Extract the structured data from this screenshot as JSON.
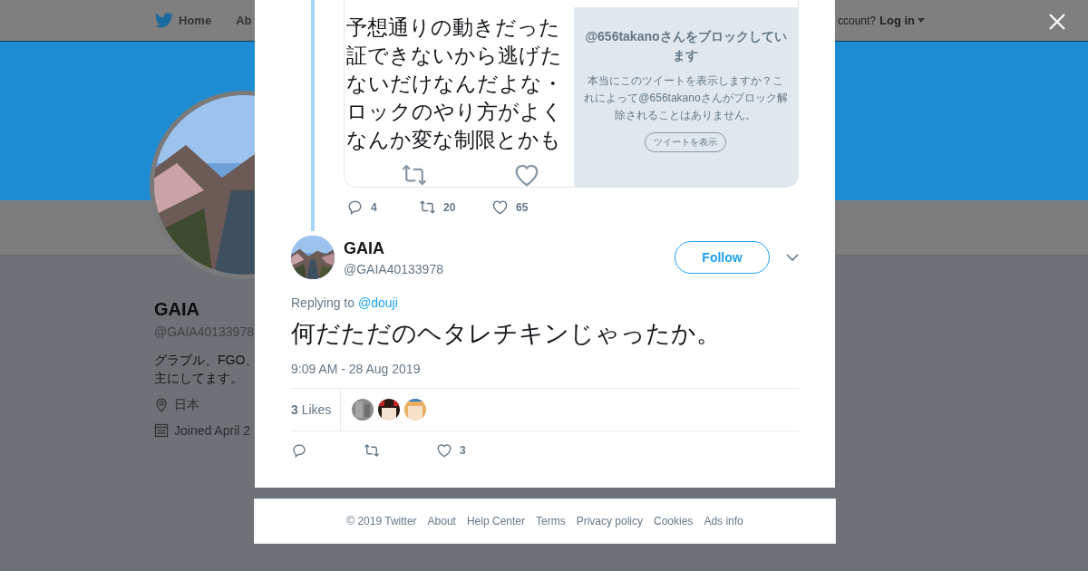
{
  "page_header": {
    "nav": [
      "Home",
      "Ab"
    ],
    "login_prompt": "ccount?",
    "login": "Log in"
  },
  "profile": {
    "name": "GAIA",
    "handle": "@GAIA40133978",
    "bio": [
      "グラブル、FGO、",
      "主にしてます。"
    ],
    "location": "日本",
    "joined": "Joined April 2"
  },
  "quoted_tweet": {
    "text_lines": [
      "予想通りの動きだった",
      "証できないから逃げた",
      "ないだけなんだよな・",
      "ロックのやり方がよく",
      "なんか変な制限とかも"
    ],
    "blocked_notice": {
      "title": "@656takanoさんをブロックしています",
      "body": "本当にこのツイートを表示しますか？これによって@656takanoさんがブロック解除されることはありません。",
      "button": "ツイートを表示"
    }
  },
  "parent_stats": [
    {
      "kind": "reply",
      "count": "4"
    },
    {
      "kind": "retweet",
      "count": "20"
    },
    {
      "kind": "like",
      "count": "65"
    }
  ],
  "tweet": {
    "name": "GAIA",
    "handle": "@GAIA40133978",
    "follow": "Follow",
    "replying_label": "Replying to",
    "replying_to": "@douji",
    "text": "何だただのヘタレチキンじゃったか。",
    "timestamp": "9:09 AM - 28 Aug 2019",
    "likes": "**3** Likes",
    "actions": [
      {
        "kind": "reply"
      },
      {
        "kind": "retweet"
      },
      {
        "kind": "like",
        "count": "3"
      }
    ]
  },
  "footer": [
    "© 2019 Twitter",
    "About",
    "Help Center",
    "Terms",
    "Privacy policy",
    "Cookies",
    "Ads info"
  ]
}
